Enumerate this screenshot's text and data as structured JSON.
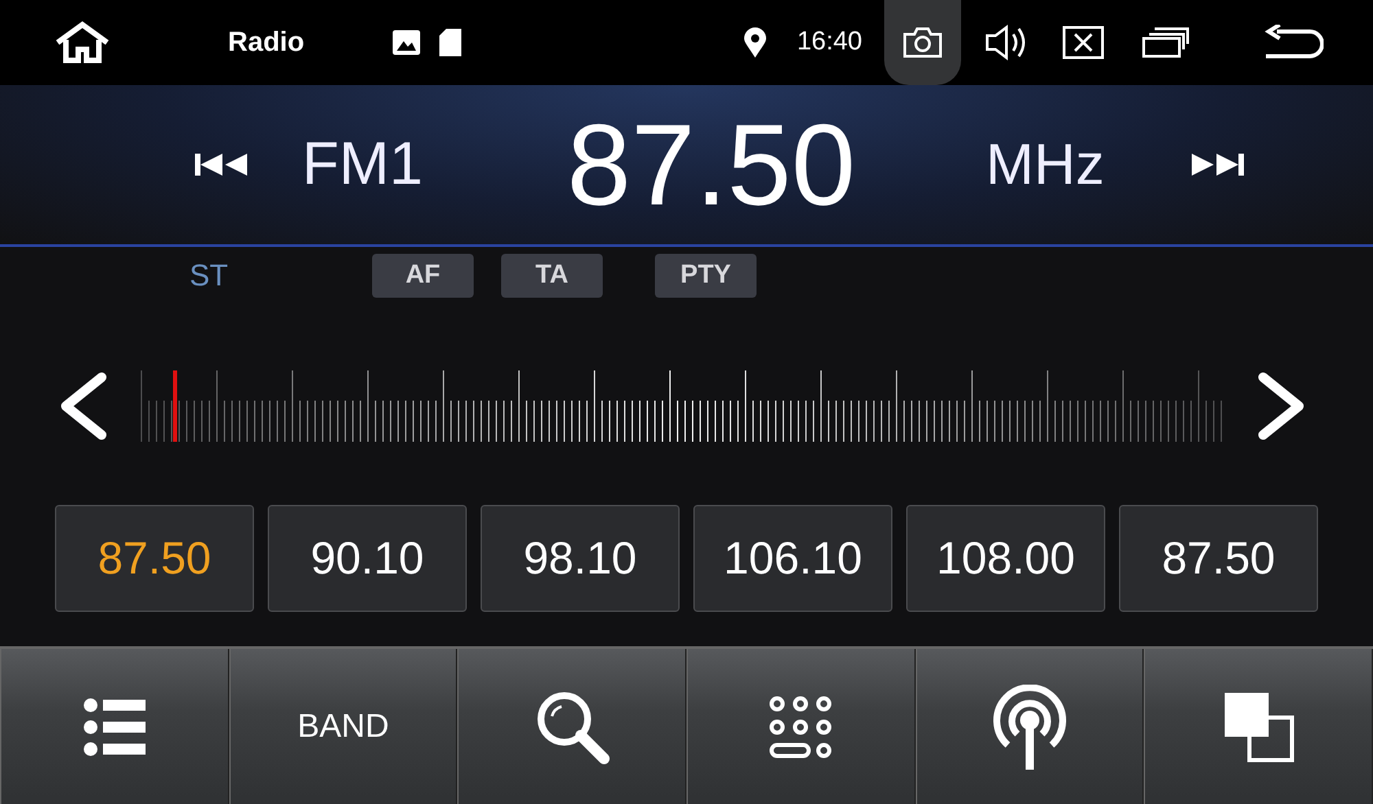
{
  "status_bar": {
    "title": "Radio",
    "time": "16:40",
    "camera_active": true
  },
  "tuner": {
    "band": "FM1",
    "frequency": "87.50",
    "unit": "MHz"
  },
  "indicators": [
    {
      "label": "ST",
      "kind": "text",
      "on": true
    },
    {
      "label": "AF",
      "kind": "flag",
      "on": false
    },
    {
      "label": "TA",
      "kind": "flag",
      "on": false
    },
    {
      "label": "PTY",
      "kind": "flag",
      "on": false
    }
  ],
  "presets": [
    {
      "label": "87.50",
      "selected": true
    },
    {
      "label": "90.10",
      "selected": false
    },
    {
      "label": "98.10",
      "selected": false
    },
    {
      "label": "106.10",
      "selected": false
    },
    {
      "label": "108.00",
      "selected": false
    },
    {
      "label": "87.50",
      "selected": false
    }
  ],
  "toolbar": [
    {
      "kind": "list"
    },
    {
      "kind": "text",
      "label": "BAND"
    },
    {
      "kind": "search"
    },
    {
      "kind": "keypad"
    },
    {
      "kind": "antenna"
    },
    {
      "kind": "squares"
    }
  ]
}
